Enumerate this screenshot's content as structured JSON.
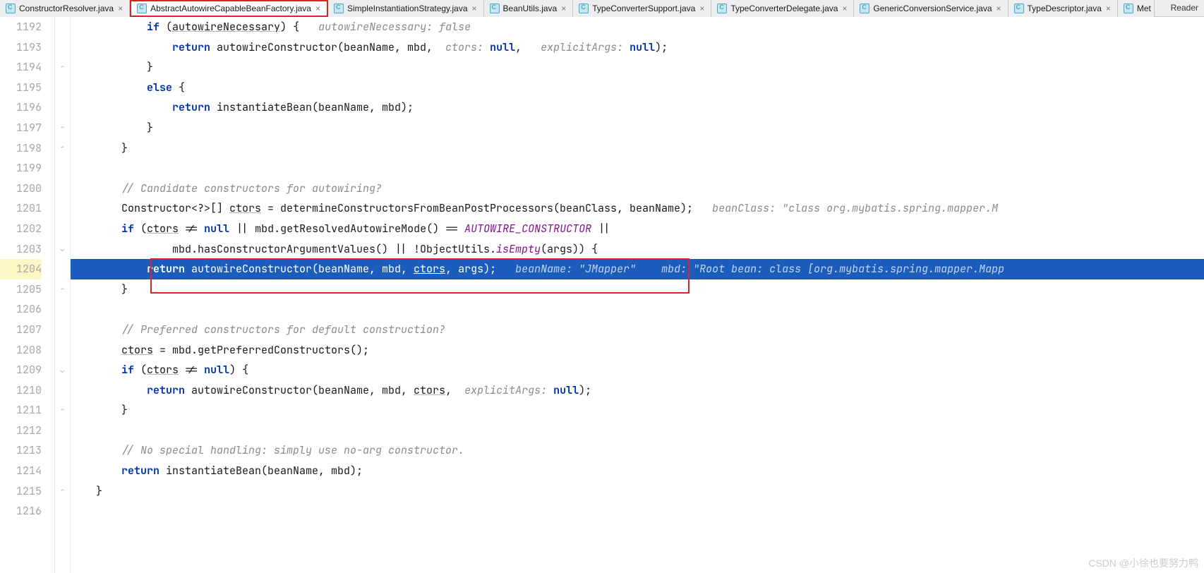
{
  "tabs": [
    {
      "name": "ConstructorResolver.java"
    },
    {
      "name": "AbstractAutowireCapableBeanFactory.java",
      "active": true,
      "highlighted": true
    },
    {
      "name": "SimpleInstantiationStrategy.java"
    },
    {
      "name": "BeanUtils.java"
    },
    {
      "name": "TypeConverterSupport.java"
    },
    {
      "name": "TypeConverterDelegate.java"
    },
    {
      "name": "GenericConversionService.java"
    },
    {
      "name": "TypeDescriptor.java"
    },
    {
      "name": "Met"
    }
  ],
  "reader_label": "Reader",
  "line_numbers": [
    "1192",
    "1193",
    "1194",
    "1195",
    "1196",
    "1197",
    "1198",
    "1199",
    "1200",
    "1201",
    "1202",
    "1203",
    "1204",
    "1205",
    "1206",
    "1207",
    "1208",
    "1209",
    "1210",
    "1211",
    "1212",
    "1213",
    "1214",
    "1215",
    "1216"
  ],
  "code": {
    "l1192": {
      "indent": "            ",
      "kw1": "if",
      "txt1": " (",
      "und": "autowireNecessary",
      "txt2": ") {   ",
      "hint": "autowireNecessary: false"
    },
    "l1193": {
      "indent": "                ",
      "kw": "return",
      "txt": " autowireConstructor(beanName, mbd, ",
      "hint1": " ctors:",
      "null1": " null",
      "txt2": ", ",
      "hint2": "  explicitArgs:",
      "null2": " null",
      "txt3": ");"
    },
    "l1194": {
      "txt": "            }"
    },
    "l1195": {
      "indent": "            ",
      "kw": "else",
      "txt": " {"
    },
    "l1196": {
      "indent": "                ",
      "kw": "return",
      "txt": " instantiateBean(beanName, mbd);"
    },
    "l1197": {
      "txt": "            }"
    },
    "l1198": {
      "txt": "        }"
    },
    "l1200": {
      "txt": "        // Candidate constructors for autowiring?"
    },
    "l1201": {
      "indent": "        ",
      "txt1": "Constructor<?>[] ",
      "und": "ctors",
      "txt2": " = determineConstructorsFromBeanPostProcessors(beanClass, beanName);   ",
      "hint": "beanClass: \"class org.mybatis.spring.mapper.M"
    },
    "l1202": {
      "indent": "        ",
      "kw": "if",
      "txt1": " (",
      "und": "ctors",
      "txt2": " != ",
      "null": "null",
      "txt3": " || mbd.getResolvedAutowireMode() == ",
      "static": "AUTOWIRE_CONSTRUCTOR",
      "txt4": " ||"
    },
    "l1203": {
      "indent": "                ",
      "txt1": "mbd.hasConstructorArgumentValues() || !ObjectUtils.",
      "static": "isEmpty",
      "txt2": "(args)) {"
    },
    "l1204": {
      "indent": "            ",
      "kw": "return",
      "txt1": " autowireConstructor(beanName, mbd, ",
      "und": "ctors",
      "txt2": ", args);   ",
      "hint1": "beanName: \"JMapper\"",
      "hint2": "    mbd: \"Root bean: class [org.mybatis.spring.mapper.Mapp"
    },
    "l1205": {
      "txt": "        }"
    },
    "l1207": {
      "txt": "        // Preferred constructors for default construction?"
    },
    "l1208": {
      "indent": "        ",
      "und": "ctors",
      "txt": " = mbd.getPreferredConstructors();"
    },
    "l1209": {
      "indent": "        ",
      "kw": "if",
      "txt1": " (",
      "und": "ctors",
      "txt2": " != ",
      "null": "null",
      "txt3": ") {"
    },
    "l1210": {
      "indent": "            ",
      "kw": "return",
      "txt1": " autowireConstructor(beanName, mbd, ",
      "und": "ctors",
      "txt2": ", ",
      "hint": " explicitArgs:",
      "null": " null",
      "txt3": ");"
    },
    "l1211": {
      "txt": "        }"
    },
    "l1213": {
      "txt": "        // No special handling: simply use no-arg constructor."
    },
    "l1214": {
      "indent": "        ",
      "kw": "return",
      "txt": " instantiateBean(beanName, mbd);"
    },
    "l1215": {
      "txt": "    }"
    }
  },
  "watermark": "CSDN @小徐也要努力鸭"
}
